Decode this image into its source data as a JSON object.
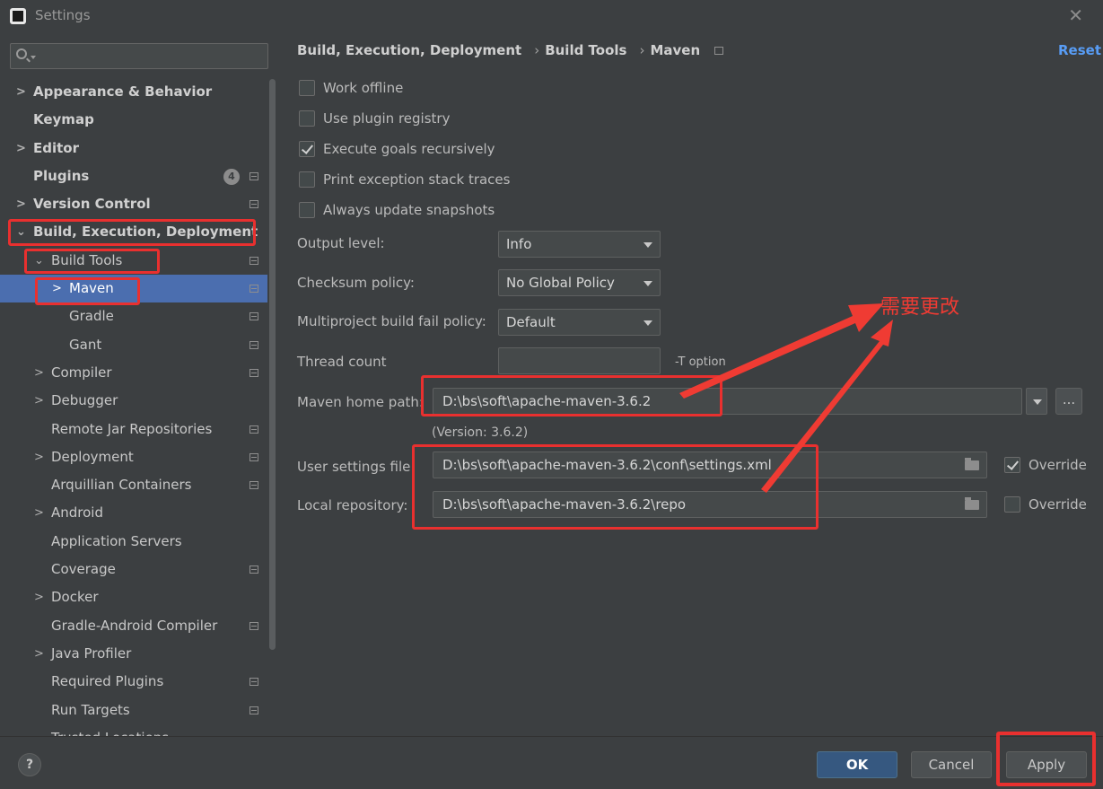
{
  "window": {
    "title": "Settings"
  },
  "search": {
    "placeholder": ""
  },
  "sidebar": {
    "items": [
      {
        "label": "Appearance & Behavior"
      },
      {
        "label": "Keymap"
      },
      {
        "label": "Editor"
      },
      {
        "label": "Plugins",
        "badge": "4"
      },
      {
        "label": "Version Control"
      },
      {
        "label": "Build, Execution, Deployment"
      },
      {
        "label": "Build Tools"
      },
      {
        "label": "Maven"
      },
      {
        "label": "Gradle"
      },
      {
        "label": "Gant"
      },
      {
        "label": "Compiler"
      },
      {
        "label": "Debugger"
      },
      {
        "label": "Remote Jar Repositories"
      },
      {
        "label": "Deployment"
      },
      {
        "label": "Arquillian Containers"
      },
      {
        "label": "Android"
      },
      {
        "label": "Application Servers"
      },
      {
        "label": "Coverage"
      },
      {
        "label": "Docker"
      },
      {
        "label": "Gradle-Android Compiler"
      },
      {
        "label": "Java Profiler"
      },
      {
        "label": "Required Plugins"
      },
      {
        "label": "Run Targets"
      },
      {
        "label": "Trusted Locations"
      }
    ]
  },
  "breadcrumb": {
    "parts": [
      "Build, Execution, Deployment",
      "Build Tools",
      "Maven"
    ],
    "separator": "›"
  },
  "reset_label": "Reset",
  "checkboxes": [
    {
      "label": "Work offline",
      "checked": false
    },
    {
      "label": "Use plugin registry",
      "checked": false
    },
    {
      "label": "Execute goals recursively",
      "checked": true
    },
    {
      "label": "Print exception stack traces",
      "checked": false
    },
    {
      "label": "Always update snapshots",
      "checked": false
    }
  ],
  "fields": {
    "output_level": {
      "label": "Output level:",
      "value": "Info"
    },
    "checksum_policy": {
      "label": "Checksum policy:",
      "value": "No Global Policy"
    },
    "multiproject": {
      "label": "Multiproject build fail policy:",
      "value": "Default"
    },
    "thread_count": {
      "label": "Thread count",
      "value": "",
      "suffix": "-T option"
    },
    "maven_home": {
      "label": "Maven home path:",
      "value": "D:\\bs\\soft\\apache-maven-3.6.2",
      "version": "(Version: 3.6.2)",
      "browse": "..."
    },
    "user_settings": {
      "label": "User settings file:",
      "value": "D:\\bs\\soft\\apache-maven-3.6.2\\conf\\settings.xml",
      "override_label": "Override",
      "override_checked": true
    },
    "local_repo": {
      "label": "Local repository:",
      "value": "D:\\bs\\soft\\apache-maven-3.6.2\\repo",
      "override_label": "Override",
      "override_checked": false
    }
  },
  "annotation": {
    "text": "需要更改",
    "color": "#ef3b33"
  },
  "footer": {
    "help": "?",
    "ok": "OK",
    "cancel": "Cancel",
    "apply": "Apply"
  },
  "colors": {
    "accent": "#4b6eaf",
    "primary_button": "#365880",
    "link": "#589df6",
    "highlight_box": "#e9302f"
  }
}
